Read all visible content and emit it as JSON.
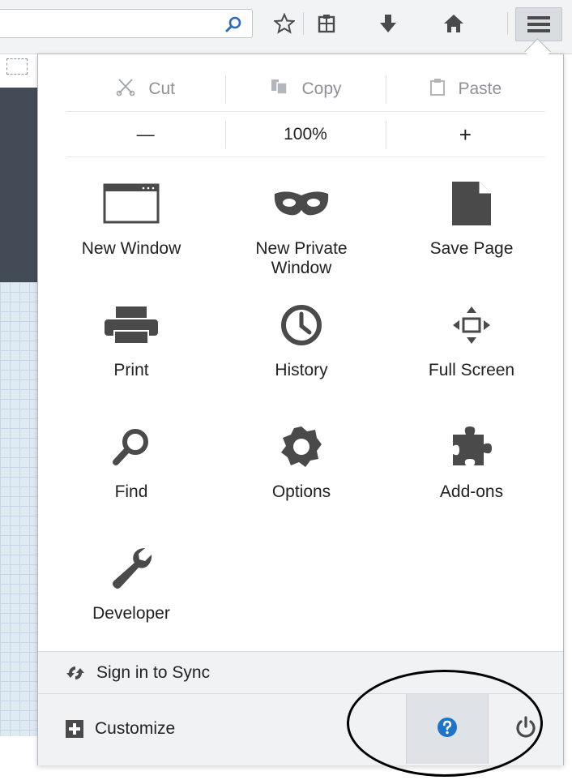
{
  "toolbar": {
    "search_icon": "search-icon",
    "bookmark_star_icon": "star-icon",
    "reading_list_icon": "clipboard-icon",
    "downloads_icon": "download-arrow-icon",
    "home_icon": "home-icon",
    "menu_icon": "hamburger-menu-icon"
  },
  "edit_controls": {
    "cut": "Cut",
    "copy": "Copy",
    "paste": "Paste"
  },
  "zoom_controls": {
    "zoom_out": "—",
    "level": "100%",
    "zoom_in": "+"
  },
  "items": [
    {
      "label": "New Window",
      "icon": "window-icon"
    },
    {
      "label": "New Private\nWindow",
      "icon": "mask-icon"
    },
    {
      "label": "Save Page",
      "icon": "page-icon"
    },
    {
      "label": "Print",
      "icon": "printer-icon"
    },
    {
      "label": "History",
      "icon": "clock-icon"
    },
    {
      "label": "Full Screen",
      "icon": "fullscreen-icon"
    },
    {
      "label": "Find",
      "icon": "magnifier-icon"
    },
    {
      "label": "Options",
      "icon": "gear-icon"
    },
    {
      "label": "Add-ons",
      "icon": "puzzle-icon"
    },
    {
      "label": "Developer",
      "icon": "wrench-icon"
    }
  ],
  "footer": {
    "sync_label": "Sign in to Sync",
    "customize_label": "Customize",
    "help_icon": "help-icon",
    "quit_icon": "power-icon"
  },
  "colors": {
    "icon_gray": "#4a4a4a",
    "help_blue": "#1f73c9",
    "footer_bg": "#f1f2f4",
    "annotation": "#000000"
  }
}
